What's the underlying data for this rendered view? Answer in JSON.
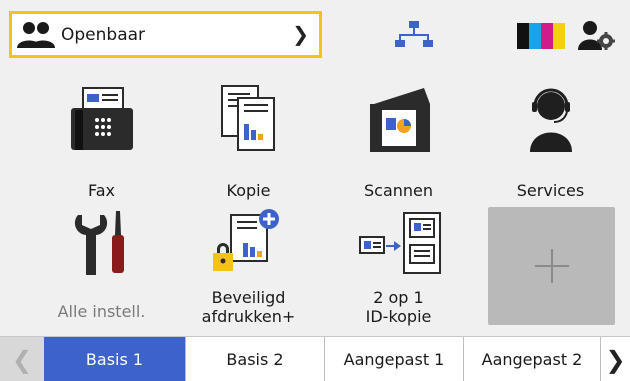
{
  "topbar": {
    "user_selector_label": "Openbaar",
    "ink_colors": [
      "#111111",
      "#1aa3e6",
      "#d11b8c",
      "#f5d10a"
    ]
  },
  "tiles": [
    {
      "name": "fax",
      "label": "Fax",
      "icon": "fax-icon"
    },
    {
      "name": "copy",
      "label": "Kopie",
      "icon": "copy-icon"
    },
    {
      "name": "scan",
      "label": "Scannen",
      "icon": "scanner-icon"
    },
    {
      "name": "services",
      "label": "Services",
      "icon": "headset-person-icon"
    },
    {
      "name": "settings",
      "label": "Alle instell.",
      "icon": "tools-icon",
      "disabled": true
    },
    {
      "name": "secure-print",
      "label_line1": "Beveiligd",
      "label_line2": "afdrukken+",
      "icon": "secure-print-icon"
    },
    {
      "name": "id-copy",
      "label_line1": "2 op 1",
      "label_line2": "ID-kopie",
      "icon": "id-card-copy-icon"
    }
  ],
  "add_tile": {
    "icon": "plus-icon"
  },
  "tabs": [
    "Basis 1",
    "Basis 2",
    "Aangepast 1",
    "Aangepast 2"
  ],
  "active_tab": "Basis 1",
  "colors": {
    "accent_tab": "#3d62c9",
    "selector_border": "#f3c21b",
    "icon_dark": "#2b2b2b",
    "icon_blue": "#3d62c9",
    "icon_orange": "#f3a21b",
    "icon_red": "#8b1a1a"
  }
}
